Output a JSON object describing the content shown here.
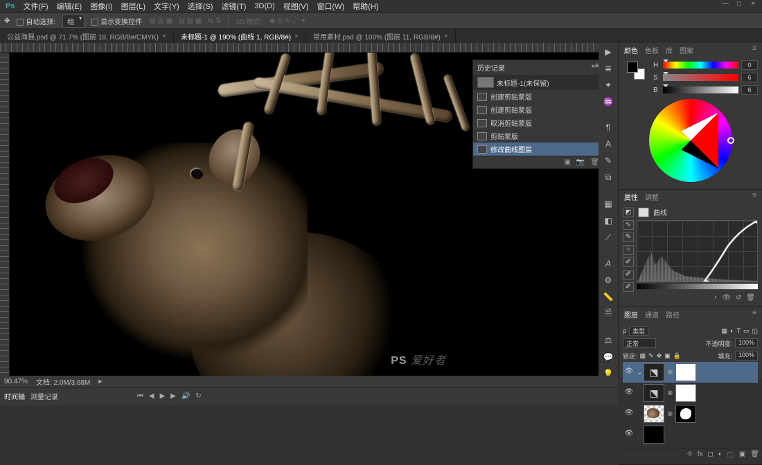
{
  "menubar": [
    "文件(F)",
    "编辑(E)",
    "图像(I)",
    "图层(L)",
    "文字(Y)",
    "选择(S)",
    "滤镜(T)",
    "3D(D)",
    "视图(V)",
    "窗口(W)",
    "帮助(H)"
  ],
  "options": {
    "auto_select": "自动选择:",
    "target": "组",
    "show_transform": "显示变换控件",
    "mode_3d": "3D 模式:"
  },
  "tabs": [
    {
      "title": "公益海报.psd @ 71.7% (图层 18, RGB/8#/CMYK)",
      "active": false
    },
    {
      "title": "未标题-1 @ 190% (曲线 1, RGB/8#)",
      "active": true
    },
    {
      "title": "常用素材.psd @ 100% (图层 11, RGB/8#)",
      "active": false
    }
  ],
  "history": {
    "title": "历史记录",
    "doc": "未标题-1(未保留)",
    "items": [
      "创建剪贴蒙版",
      "创建剪贴蒙版",
      "取消剪贴蒙版",
      "剪贴蒙版",
      "修改曲线图层"
    ],
    "active_index": 4
  },
  "status": {
    "zoom": "90.47%",
    "doc": "文档: 2.0M/3.68M"
  },
  "timeline": {
    "tab1": "时间轴",
    "tab2": "测量记录"
  },
  "panels": {
    "color": {
      "tabs": [
        "颜色",
        "色板",
        "库",
        "图案"
      ],
      "active": 0,
      "h": 0,
      "s": 6,
      "b": 6
    },
    "properties": {
      "tabs": [
        "属性",
        "调整"
      ],
      "active": 0,
      "adjust_label": "曲线"
    },
    "layers": {
      "tabs": [
        "图层",
        "通道",
        "路径"
      ],
      "active": 0,
      "kind": "类型",
      "blend": "正常",
      "opacity_label": "不透明度:",
      "opacity": "100%",
      "lock_label": "锁定:",
      "fill_label": "填充:",
      "fill": "100%"
    }
  },
  "watermark_text": "爱好者",
  "watermark_logo": "PS"
}
